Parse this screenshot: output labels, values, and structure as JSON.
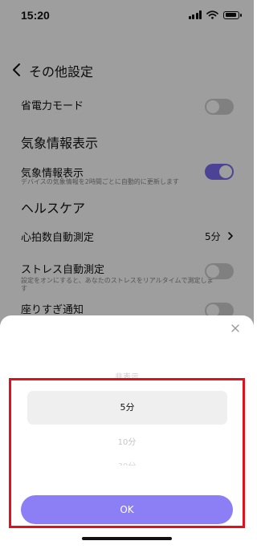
{
  "status_bar": {
    "time": "15:20",
    "icons": [
      "signal-icon",
      "wifi-icon",
      "battery-icon"
    ]
  },
  "header": {
    "back_icon": "chevron-left-icon",
    "title": "その他設定"
  },
  "settings": {
    "power_saving": {
      "label": "省電力モード",
      "toggle_on": false
    },
    "weather_section_title": "気象情報表示",
    "weather": {
      "label": "気象情報表示",
      "sub": "デバイスの気象情報を2時間ごとに自動的に更新します",
      "toggle_on": true
    },
    "health_section_title": "ヘルスケア",
    "heart_rate": {
      "label": "心拍数自動測定",
      "value": "5分"
    },
    "stress": {
      "label": "ストレス自動測定",
      "sub": "設定をオンにすると、あなたのストレスをリアルタイムで測定します",
      "toggle_on": false
    },
    "sitting": {
      "label": "座りすぎ通知",
      "toggle_on": false
    }
  },
  "sheet": {
    "close_icon": "close-icon",
    "picker": {
      "above": "非表示",
      "selected": "5分",
      "below1": "10分",
      "below2": "30分"
    },
    "ok_label": "OK"
  },
  "colors": {
    "accent": "#7b6cf2",
    "ok_button": "#8c7ff5",
    "highlight": "#e0101c",
    "toggle_off": "#cfcfcf"
  }
}
